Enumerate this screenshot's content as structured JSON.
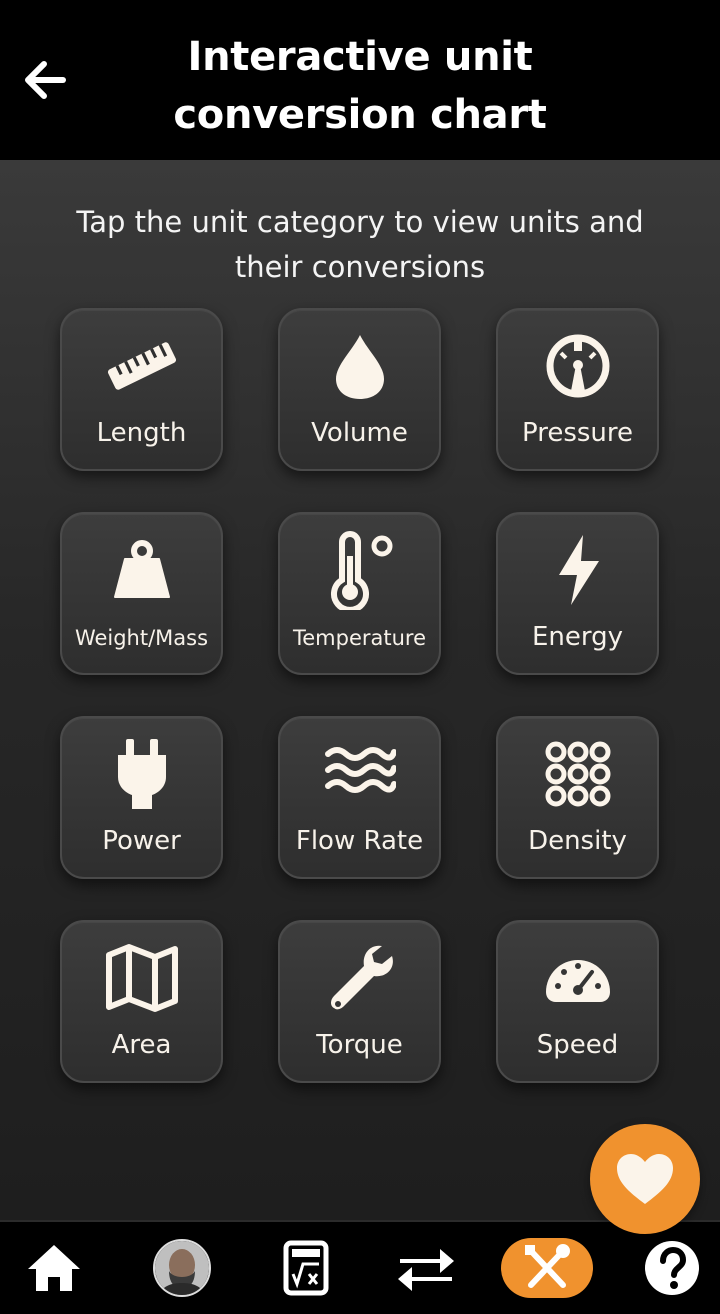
{
  "header": {
    "title": "Interactive unit conversion chart",
    "back_icon": "arrow-left-icon"
  },
  "main": {
    "subtitle": "Tap the unit category to view units and their conversions",
    "categories": [
      {
        "label": "Length",
        "icon": "ruler-icon"
      },
      {
        "label": "Volume",
        "icon": "droplet-icon"
      },
      {
        "label": "Pressure",
        "icon": "gauge-icon"
      },
      {
        "label": "Weight/Mass",
        "icon": "weight-icon"
      },
      {
        "label": "Temperature",
        "icon": "thermometer-icon"
      },
      {
        "label": "Energy",
        "icon": "lightning-icon"
      },
      {
        "label": "Power",
        "icon": "plug-icon"
      },
      {
        "label": "Flow Rate",
        "icon": "water-waves-icon"
      },
      {
        "label": "Density",
        "icon": "circles-grid-icon"
      },
      {
        "label": "Area",
        "icon": "map-icon"
      },
      {
        "label": "Torque",
        "icon": "wrench-icon"
      },
      {
        "label": "Speed",
        "icon": "speedometer-icon"
      }
    ]
  },
  "fab": {
    "icon": "heart-icon"
  },
  "bottom_nav": {
    "items": [
      {
        "icon": "home-icon"
      },
      {
        "icon": "avatar"
      },
      {
        "icon": "calculator-icon"
      },
      {
        "icon": "swap-arrows-icon"
      },
      {
        "icon": "tools-icon",
        "active": true
      },
      {
        "icon": "help-icon"
      }
    ]
  },
  "colors": {
    "accent": "#f0922e",
    "icon": "#fbf4ea",
    "header_bg": "#000000",
    "tile_bg": "#353535"
  }
}
